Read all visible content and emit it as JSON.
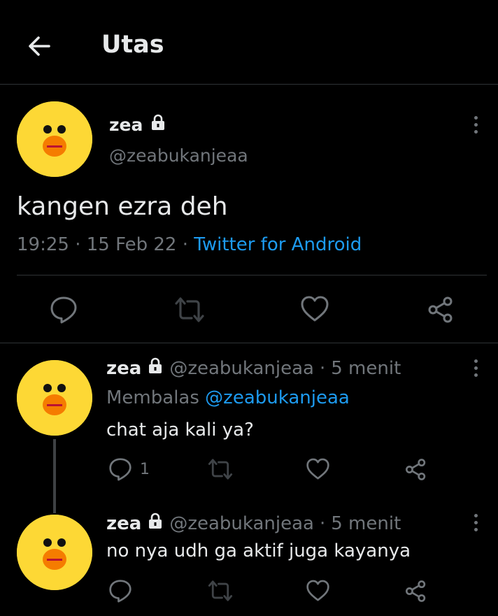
{
  "header": {
    "title": "Utas"
  },
  "main_tweet": {
    "name": "zea",
    "handle": "@zeabukanjeaa",
    "text": "kangen ezra deh",
    "time": "19:25",
    "date": "15 Feb 22",
    "source": "Twitter for Android"
  },
  "replies": [
    {
      "name": "zea",
      "handle": "@zeabukanjeaa",
      "age": "5 menit",
      "replying_prefix": "Membalas",
      "replying_to": "@zeabukanjeaa",
      "text": "chat aja kali ya?",
      "reply_count": "1"
    },
    {
      "name": "zea",
      "handle": "@zeabukanjeaa",
      "age": "5 menit",
      "text": "no nya udh ga aktif juga kayanya"
    }
  ],
  "separators": {
    "dot": "·"
  },
  "colors": {
    "background": "#000000",
    "accent": "#1d9bf0",
    "muted": "#71767b",
    "avatar": "#fdd835"
  },
  "icons": [
    "back-arrow-icon",
    "lock-icon",
    "more-icon",
    "reply-icon",
    "retweet-icon",
    "like-icon",
    "share-icon"
  ]
}
